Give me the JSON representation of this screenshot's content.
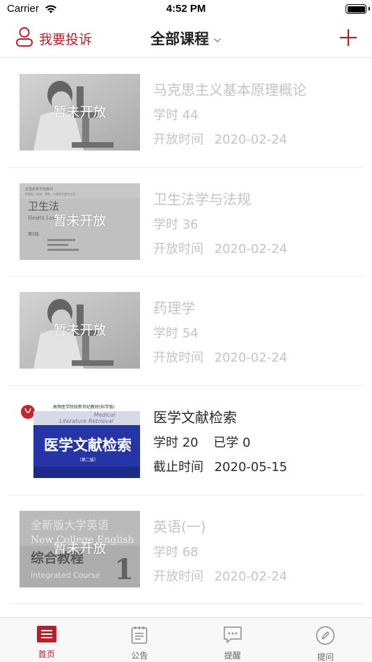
{
  "status_bar": {
    "carrier": "Carrier",
    "time": "4:52 PM"
  },
  "nav": {
    "left_label": "我要投诉",
    "title": "全部课程"
  },
  "colors": {
    "accent": "#b5202a",
    "dim_text": "#c4c4c4"
  },
  "courses": [
    {
      "title": "马克思主义基本原理概论",
      "hours_label": "学时",
      "hours": "44",
      "date_label": "开放时间",
      "date": "2020-02-24",
      "overlay": "暂未开放",
      "thumb": "microscope"
    },
    {
      "title": "卫生法学与法规",
      "hours_label": "学时",
      "hours": "36",
      "date_label": "开放时间",
      "date": "2020-02-24",
      "overlay": "暂未开放",
      "thumb": "book-cover-health-law",
      "cover": {
        "top_text": "全国高等学校教材",
        "subtitle": "供基础、临床、预防、口腔医学类专业用",
        "title": "卫生法",
        "en": "Health Law",
        "edition": "第5版"
      }
    },
    {
      "title": "药理学",
      "hours_label": "学时",
      "hours": "54",
      "date_label": "开放时间",
      "date": "2020-02-24",
      "overlay": "暂未开放",
      "thumb": "microscope"
    },
    {
      "title": "医学文献检索",
      "hours_label": "学时",
      "hours": "20",
      "learned_label": "已学",
      "learned": "0",
      "date_label": "截止时间",
      "date": "2020-05-15",
      "thumb": "book-cover-literature",
      "cover": {
        "top_text": "高等医学院校新世纪教材(科学版)",
        "en1": "Medical",
        "en2": "Literature Retrieval",
        "title": "医学文献检索",
        "edition": "（第二版）"
      }
    },
    {
      "title": "英语(一)",
      "hours_label": "学时",
      "hours": "68",
      "date_label": "开放时间",
      "date": "2020-02-24",
      "overlay": "暂未开放",
      "thumb": "book-cover-english",
      "cover": {
        "title1": "全新版大学英语",
        "en": "New College English",
        "title2": "综合教程",
        "en2": "Integrated Course",
        "num": "1"
      }
    }
  ],
  "tabs": [
    {
      "label": "首页",
      "icon": "home-list-icon",
      "selected": true
    },
    {
      "label": "公告",
      "icon": "clipboard-icon",
      "selected": false
    },
    {
      "label": "提醒",
      "icon": "chat-bubble-icon",
      "selected": false
    },
    {
      "label": "提问",
      "icon": "pencil-circle-icon",
      "selected": false
    }
  ]
}
